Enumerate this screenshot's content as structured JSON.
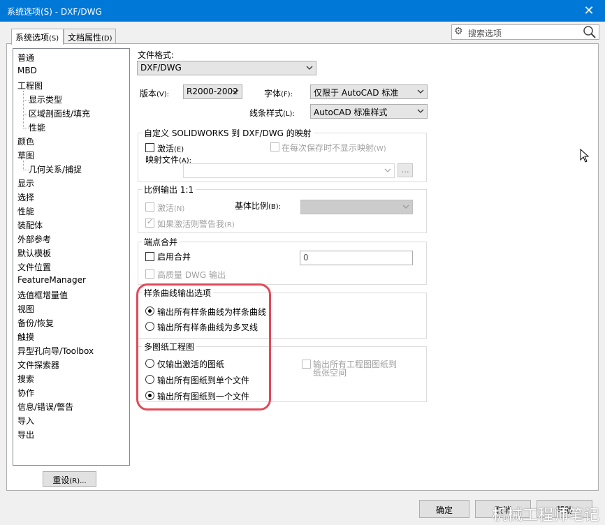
{
  "window": {
    "title": "系统选项(S) - DXF/DWG",
    "close_glyph": "✕"
  },
  "tabs": [
    {
      "label": "系统选项",
      "accel": "(S)"
    },
    {
      "label": "文档属性",
      "accel": "(D)"
    }
  ],
  "search": {
    "placeholder": "搜索选项"
  },
  "tree": {
    "items": [
      {
        "label": "普通",
        "child": false
      },
      {
        "label": "MBD",
        "child": false
      },
      {
        "label": "工程图",
        "child": false
      },
      {
        "label": "显示类型",
        "child": true
      },
      {
        "label": "区域剖面线/填充",
        "child": true
      },
      {
        "label": "性能",
        "child": true
      },
      {
        "label": "颜色",
        "child": false
      },
      {
        "label": "草图",
        "child": false
      },
      {
        "label": "几何关系/捕捉",
        "child": true
      },
      {
        "label": "显示",
        "child": false
      },
      {
        "label": "选择",
        "child": false
      },
      {
        "label": "性能",
        "child": false
      },
      {
        "label": "装配体",
        "child": false
      },
      {
        "label": "外部参考",
        "child": false
      },
      {
        "label": "默认模板",
        "child": false
      },
      {
        "label": "文件位置",
        "child": false
      },
      {
        "label": "FeatureManager",
        "child": false
      },
      {
        "label": "选值框增量值",
        "child": false
      },
      {
        "label": "视图",
        "child": false
      },
      {
        "label": "备份/恢复",
        "child": false
      },
      {
        "label": "触摸",
        "child": false
      },
      {
        "label": "异型孔向导/Toolbox",
        "child": false
      },
      {
        "label": "文件探索器",
        "child": false
      },
      {
        "label": "搜索",
        "child": false
      },
      {
        "label": "协作",
        "child": false
      },
      {
        "label": "信息/错误/警告",
        "child": false
      },
      {
        "label": "导入",
        "child": false
      },
      {
        "label": "导出",
        "child": false
      }
    ]
  },
  "reset_button": {
    "label": "重设",
    "accel": "(R)..."
  },
  "file_format": {
    "label": "文件格式:",
    "value": "DXF/DWG"
  },
  "version": {
    "label": "版本",
    "accel": "(V):",
    "value": "R2000-2002"
  },
  "font": {
    "label": "字体",
    "accel": "(F):",
    "value": "仅限于 AutoCAD 标准"
  },
  "line_style": {
    "label": "线条样式",
    "accel": "(L):",
    "value": "AutoCAD 标准样式"
  },
  "mapping_group": {
    "legend": "自定义 SOLIDWORKS 到 DXF/DWG 的映射",
    "activate": {
      "label": "激活",
      "accel": "(E)"
    },
    "no_show": {
      "label": "在每次保存时不显示映射",
      "accel": "(W)"
    },
    "map_file": {
      "label": "映射文件",
      "accel": "(A):"
    },
    "browse": "..."
  },
  "scale_group": {
    "legend": "比例输出 1:1",
    "activate": {
      "label": "激活",
      "accel": "(N)"
    },
    "base_scale": {
      "label": "基体比例",
      "accel": "(B):"
    },
    "warn": {
      "label": "如果激活则警告我",
      "accel": "(R)"
    }
  },
  "endpoint_group": {
    "legend": "端点合并",
    "enable": "启用合并",
    "value": "0",
    "hq": "高质量 DWG 输出"
  },
  "spline_group": {
    "legend": "样条曲线输出选项",
    "opt1": "输出所有样条曲线为样条曲线",
    "opt2": "输出所有样条曲线为多叉线"
  },
  "multi_group": {
    "legend": "多图纸工程图",
    "opt1": "仅输出激活的图纸",
    "opt2": "输出所有图纸到单个文件",
    "opt3": "输出所有图纸到一个文件",
    "paper_space_1": "输出所有工程图图纸到",
    "paper_space_2": "纸张空间"
  },
  "footer": {
    "ok": "确定",
    "cancel": "取消",
    "help": "帮助"
  },
  "watermark": "机械工程师笔记",
  "colors": {
    "titlebar": "#0078d7",
    "highlight": "#e04a5a"
  }
}
